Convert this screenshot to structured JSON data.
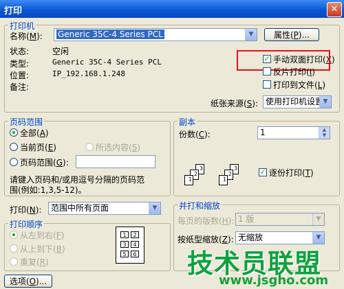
{
  "window": {
    "title": "打印",
    "close_glyph": "✕"
  },
  "printer": {
    "group_label": "打印机",
    "name_label": "名称",
    "name_key": "M",
    "name_value": "Generic 35C-4 Series PCL",
    "properties_label": "属性",
    "properties_key": "P",
    "status_label": "状态:",
    "status_value": "空闲",
    "type_label": "类型:",
    "type_value": "Generic 35C-4 Series PCL",
    "location_label": "位置:",
    "location_value": "IP_192.168.1.248",
    "comment_label": "备注:",
    "manual_duplex_label": "手动双面打印",
    "manual_duplex_key": "X",
    "manual_duplex_checked": true,
    "reverse_label": "反片打印",
    "reverse_key": "I",
    "reverse_checked": false,
    "print_to_file_label": "打印到文件",
    "print_to_file_key": "L",
    "print_to_file_checked": false,
    "paper_source_label": "纸张来源",
    "paper_source_key": "S",
    "paper_source_value": "使用打印机设置"
  },
  "page_range": {
    "group_label": "页码范围",
    "all_label": "全部",
    "all_key": "A",
    "current_label": "当前页",
    "current_key": "E",
    "selection_label": "所选内容",
    "selection_key": "S",
    "pages_label": "页码范围",
    "pages_key": "G",
    "pages_value": "",
    "hint_line1": "请键入页码和/或用逗号分隔的页码范",
    "hint_line2": "围(例如:1,3,5-12)。"
  },
  "copies": {
    "group_label": "副本",
    "count_label": "份数",
    "count_key": "C",
    "count_value": "1",
    "collate_label": "逐份打印",
    "collate_key": "T",
    "collate_checked": true
  },
  "print_what": {
    "label": "打印",
    "key": "N",
    "value": "范围中所有页面"
  },
  "print_order": {
    "group_label": "打印顺序",
    "left_right_label": "从左到右",
    "left_right_key": "F",
    "top_bottom_label": "从上到下",
    "top_bottom_key": "B",
    "repeat_label": "重复",
    "repeat_key": "R"
  },
  "zoom": {
    "group_label": "并打和缩放",
    "pages_per_sheet_label": "每页的版数",
    "pages_per_sheet_key": "H",
    "pages_per_sheet_value": "1 版",
    "scale_label": "按纸型缩放",
    "scale_key": "Z",
    "scale_value": "无缩放"
  },
  "options_button": {
    "label": "选项",
    "key": "O"
  },
  "watermark": {
    "text": "技术员联盟",
    "url": "www.jsgho.com"
  },
  "glyphs": {
    "check": "✓",
    "arrow_down": "▼",
    "spin_up": "▲",
    "spin_down": "▼"
  },
  "order_preview": [
    "1",
    "2",
    "3",
    "4",
    "5",
    "6"
  ],
  "collate_pages": [
    "1",
    "2",
    "3",
    "1",
    "2",
    "3"
  ]
}
